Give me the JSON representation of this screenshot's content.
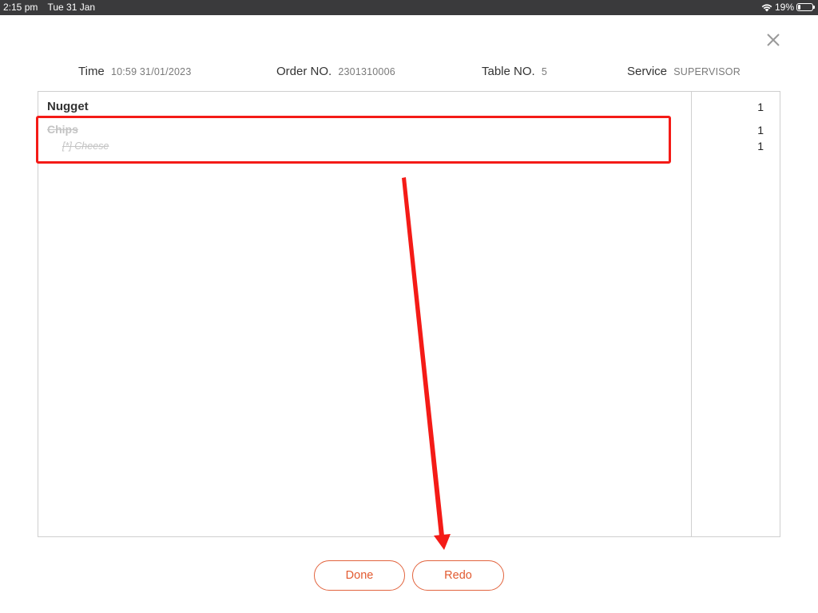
{
  "status_bar": {
    "time": "2:15 pm",
    "date": "Tue 31 Jan",
    "battery": "19%",
    "battery_level": 0.19,
    "icons": [
      "wifi-icon",
      "battery-icon"
    ]
  },
  "header": {
    "close_icon": "close-icon",
    "time_label": "Time",
    "time_value": "10:59 31/01/2023",
    "order_label": "Order NO.",
    "order_value": "2301310006",
    "table_label": "Table NO.",
    "table_value": "5",
    "service_label": "Service",
    "service_value": "SUPERVISOR"
  },
  "items": [
    {
      "name": "Nugget",
      "qty": "1",
      "struck": false
    },
    {
      "name": "Chips",
      "qty": "1",
      "struck": true
    },
    {
      "name": "[*] Cheese",
      "qty": "1",
      "struck": true,
      "modifier": true
    }
  ],
  "buttons": {
    "done": "Done",
    "redo": "Redo"
  },
  "colors": {
    "accent": "#e25a30",
    "annotation": "#f41b17",
    "struck_text": "#c4c4c4",
    "status_bar": "#3a3a3c"
  }
}
